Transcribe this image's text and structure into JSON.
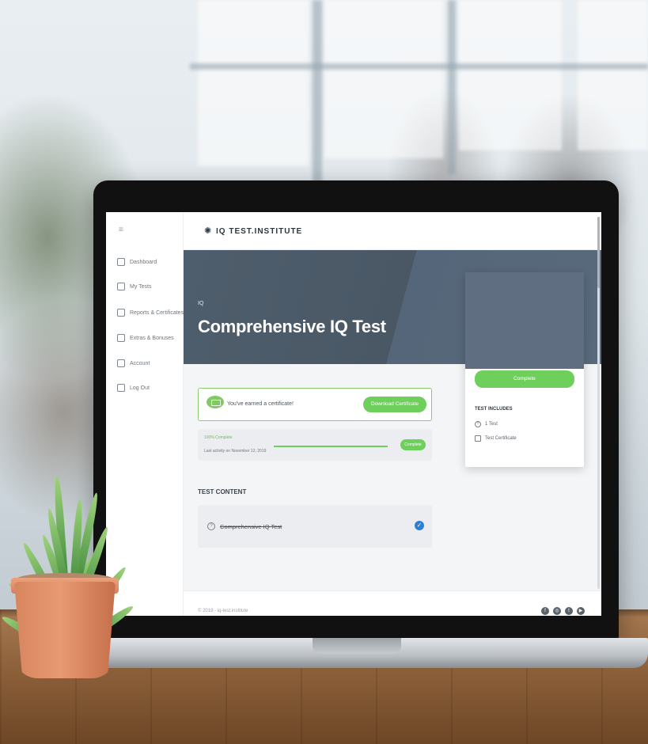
{
  "app": {
    "logo_text": "IQ TEST.INSTITUTE"
  },
  "sidebar": {
    "items": [
      {
        "label": "Dashboard",
        "icon": "home-icon"
      },
      {
        "label": "My Tests",
        "icon": "edit-icon"
      },
      {
        "label": "Reports & Certificates",
        "icon": "certificate-icon"
      },
      {
        "label": "Extras & Bonuses",
        "icon": "gift-icon"
      },
      {
        "label": "Account",
        "icon": "account-icon"
      },
      {
        "label": "Log Out",
        "icon": "logout-icon"
      }
    ]
  },
  "hero": {
    "kicker": "IQ",
    "title": "Comprehensive IQ Test"
  },
  "certificate": {
    "message": "You've earned a certificate!",
    "download_label": "Download Certificate"
  },
  "progress": {
    "percent_label": "100% Complete",
    "activity": "Last activity on November 12, 2019",
    "value": 1.0,
    "button_label": "Complete"
  },
  "test_content": {
    "heading": "TEST CONTENT",
    "items": [
      {
        "label": "Comprehensive IQ Test",
        "completed": true
      }
    ]
  },
  "card": {
    "button_label": "Complete",
    "heading": "TEST INCLUDES",
    "items": [
      {
        "label": "1 Test",
        "icon": "question-icon"
      },
      {
        "label": "Test Certificate",
        "icon": "certificate-icon"
      }
    ]
  },
  "footer": {
    "copyright": "© 2019 - iq-test.institute",
    "social": [
      "facebook-icon",
      "instagram-icon",
      "twitter-icon",
      "youtube-icon"
    ]
  },
  "colors": {
    "accent_green": "#6fcf5c",
    "hero_bg": "#4f5e6c",
    "check_blue": "#2f7fd6"
  }
}
